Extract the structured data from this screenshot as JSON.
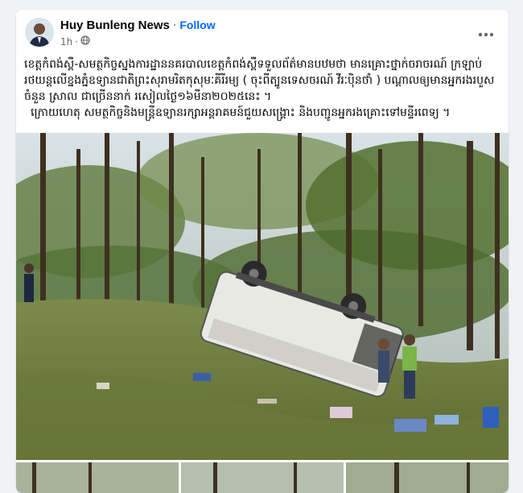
{
  "post": {
    "author": "Huy Bunleng News",
    "separator": "·",
    "follow_label": "Follow",
    "time": "1h",
    "audience_icon": "globe-icon",
    "more_icon": "more-horizontal-icon",
    "text_line1": "ខេត្តកំពង់ស្ពឺ-សមត្ថកិច្ចស្នងការដ្ឋាននគរបាលខេត្តកំពង់ស្ពឺទទួលព័ត៌មានបឋមថា មានគ្រោះថ្នាក់ចរាចរណ៍ ក្រឡាប់រថយន្តលើខ្នងភ្នំឧទ្យានជាតិព្រះសុរាមរិត​កុសុមៈគីរីរម្យ ( ចុះពីត្បូនទេសចរណ៍ វីរៈបុិនថាំ ) បណ្តាលឲ្យមានអ្នករងរបួស ចំនួន ស្រាល ជាច្រើននាក់ រសៀលថ្ងៃ១៦មីនា២០២៥នេះ ។",
    "text_line2": "ក្រោយហេតុ សមត្ថកិច្ចនិងមន្ត្រីឧទ្យានរក្សាអន្តរាគមន៍ជួយសង្គ្រោះ និងបញ្ជូនអ្នករងគ្រោះទៅមន្ទីរពេទ្យ ។",
    "photo_alt": "overturned vehicle on forested hillside",
    "thumb_count": 3
  },
  "colors": {
    "background": "#f0f2f5",
    "card": "#ffffff",
    "author": "#050505",
    "follow": "#0866ff",
    "meta": "#65676b"
  }
}
